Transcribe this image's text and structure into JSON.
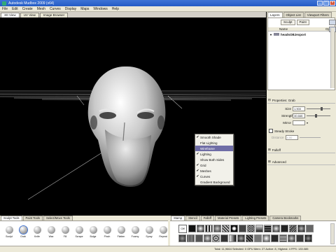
{
  "window": {
    "title": "Autodesk Mudbox 2009 (x64)"
  },
  "menu": [
    "File",
    "Edit",
    "Create",
    "Mesh",
    "Curves",
    "Display",
    "Maps",
    "Windows",
    "Help"
  ],
  "view_tabs": [
    "3D View",
    "UV View",
    "Image Browser"
  ],
  "right_panel": {
    "tabs": [
      "Layers",
      "Object List",
      "Viewport Filters"
    ],
    "buttons": [
      "Sculpt",
      "Paint"
    ],
    "columns": [
      "Name",
      "Opacit"
    ],
    "layer_name": "headsOBJexport",
    "properties_title": "Properties: Grab",
    "size_label": "Size",
    "size_value": "1.900",
    "strength_label": "Strength",
    "strength_value": "30.665",
    "mirror_label": "Mirror",
    "steady_label": "Steady Stroke",
    "distance_label": "Distance",
    "distance_value": "4.00",
    "falloff_label": "Falloff",
    "advanced_label": "Advanced"
  },
  "context_menu": [
    {
      "label": "Smooth Shade",
      "checked": true
    },
    {
      "label": "Flat Lighting",
      "checked": false
    },
    {
      "label": "Wireframe",
      "checked": false,
      "highlighted": true
    },
    {
      "label": "Lighting",
      "checked": true
    },
    {
      "label": "Show Both Sides",
      "checked": false
    },
    {
      "label": "Grid",
      "checked": true
    },
    {
      "label": "Meshes",
      "checked": true
    },
    {
      "label": "Curves",
      "checked": true
    },
    {
      "label": "Gradient Background",
      "checked": false
    }
  ],
  "bottom": {
    "left_tabs": [
      "Sculpt Tools",
      "Paint Tools",
      "Select/Move Tools"
    ],
    "tools": [
      "Sculpt",
      "Grab",
      "Knife",
      "Wax",
      "Fill",
      "Scrape",
      "Bulge",
      "Pinch",
      "Flatten",
      "Foamy",
      "Spray",
      "Repeat"
    ],
    "right_tabs": [
      "Stamp",
      "Stencil",
      "Falloff",
      "Material Presets",
      "Lighting Presets",
      "Camera Bookmarks"
    ],
    "off_label": "Off"
  },
  "status": "Total: 11,9664  Selected: 0 GPU Mem: 27  Active: 8, Highest: 4  FPS: 133.085"
}
